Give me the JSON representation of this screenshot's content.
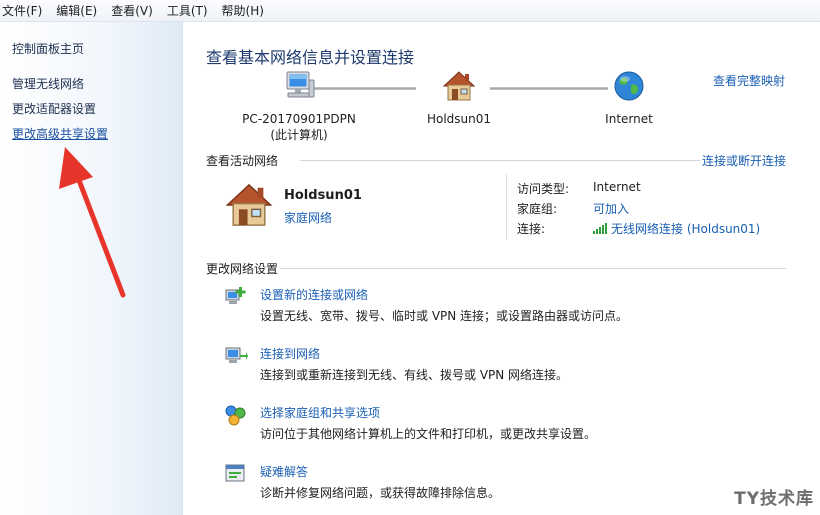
{
  "menubar": {
    "items": [
      "文件(F)",
      "编辑(E)",
      "查看(V)",
      "工具(T)",
      "帮助(H)"
    ]
  },
  "sidebar": {
    "home": "控制面板主页",
    "links": [
      "管理无线网络",
      "更改适配器设置",
      "更改高级共享设置"
    ]
  },
  "main": {
    "title": "查看基本网络信息并设置连接",
    "map_link": "查看完整映射",
    "map": {
      "computer_name": "PC-20170901PDPN",
      "computer_note": "(此计算机)",
      "network": "Holdsun01",
      "internet": "Internet"
    },
    "active": {
      "heading": "查看活动网络",
      "connect_link": "连接或断开连接",
      "network_name": "Holdsun01",
      "network_type": "家庭网络",
      "access_label": "访问类型:",
      "access_value": "Internet",
      "homegroup_label": "家庭组:",
      "homegroup_value": "可加入",
      "connection_label": "连接:",
      "connection_value": "无线网络连接 (Holdsun01)"
    },
    "change": {
      "heading": "更改网络设置",
      "tasks": [
        {
          "link": "设置新的连接或网络",
          "desc": "设置无线、宽带、拨号、临时或 VPN 连接；或设置路由器或访问点。"
        },
        {
          "link": "连接到网络",
          "desc": "连接到或重新连接到无线、有线、拨号或 VPN 网络连接。"
        },
        {
          "link": "选择家庭组和共享选项",
          "desc": "访问位于其他网络计算机上的文件和打印机，或更改共享设置。"
        },
        {
          "link": "疑难解答",
          "desc": "诊断并修复网络问题，或获得故障排除信息。"
        }
      ]
    }
  },
  "watermark": "TY技术库",
  "colors": {
    "link": "#1a5fb4",
    "title": "#1e3a6e",
    "arrow": "#e8352b"
  }
}
